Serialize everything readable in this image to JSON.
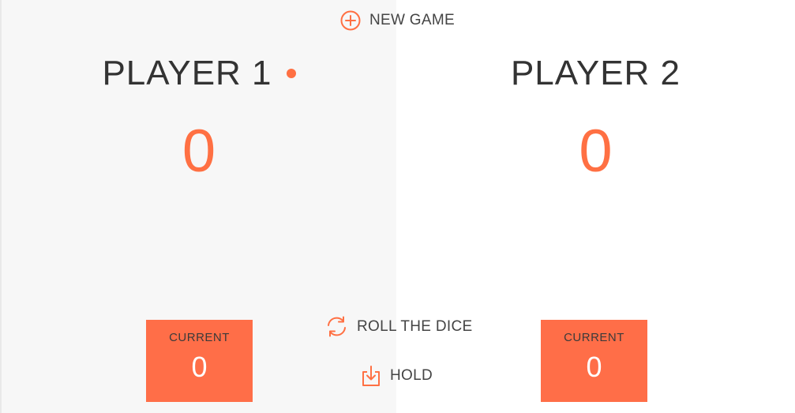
{
  "colors": {
    "accent": "#ff7043",
    "current_box": "#ff6e48",
    "panel_active_bg": "#f7f7f7",
    "panel_bg": "#ffffff",
    "text_dark": "#333333"
  },
  "controls": {
    "new_game": {
      "label": "NEW GAME",
      "icon": "plus-circle-icon"
    },
    "roll_dice": {
      "label": "ROLL THE DICE",
      "icon": "refresh-icon"
    },
    "hold": {
      "label": "HOLD",
      "icon": "download-icon"
    }
  },
  "players": [
    {
      "name": "PLAYER 1",
      "score": "0",
      "current_label": "CURRENT",
      "current_score": "0",
      "active": true
    },
    {
      "name": "PLAYER 2",
      "score": "0",
      "current_label": "CURRENT",
      "current_score": "0",
      "active": false
    }
  ]
}
